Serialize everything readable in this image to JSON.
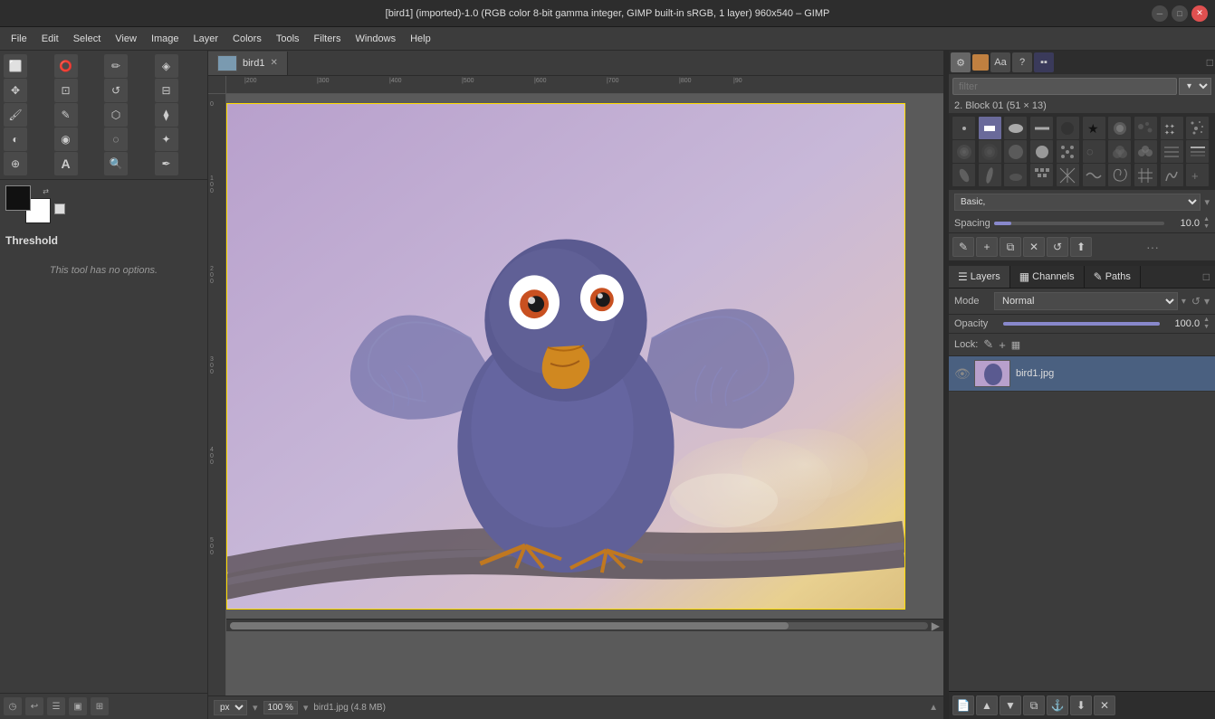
{
  "titlebar": {
    "title": "[bird1] (imported)-1.0 (RGB color 8-bit gamma integer, GIMP built-in sRGB, 1 layer) 960x540 – GIMP"
  },
  "menubar": {
    "items": [
      "File",
      "Edit",
      "Select",
      "View",
      "Image",
      "Layer",
      "Colors",
      "Tools",
      "Filters",
      "Windows",
      "Help"
    ]
  },
  "canvas": {
    "tab_name": "bird1",
    "close_label": "✕"
  },
  "bottom_bar": {
    "unit": "px",
    "zoom": "100 %",
    "file_info": "bird1.jpg (4.8 MB)"
  },
  "tool_options": {
    "title": "Threshold",
    "description": "This tool has\nno options."
  },
  "brushes": {
    "filter_placeholder": "filter",
    "preset_label": "2. Block 01 (51 × 13)",
    "preset_dropdown": "Basic,",
    "spacing_label": "Spacing",
    "spacing_value": "10.0"
  },
  "layers_panel": {
    "tabs": [
      {
        "label": "Layers",
        "icon": "☰",
        "active": true
      },
      {
        "label": "Channels",
        "icon": "▦"
      },
      {
        "label": "Paths",
        "icon": "✎"
      }
    ],
    "mode_label": "Mode",
    "mode_value": "Normal",
    "opacity_label": "Opacity",
    "opacity_value": "100.0",
    "lock_label": "Lock:",
    "layer_name": "bird1.jpg"
  },
  "layer_actions": {
    "new_layer": "📄",
    "raise": "▲",
    "lower": "▼",
    "duplicate": "⧉",
    "anchor": "⚓",
    "delete": "✕"
  }
}
